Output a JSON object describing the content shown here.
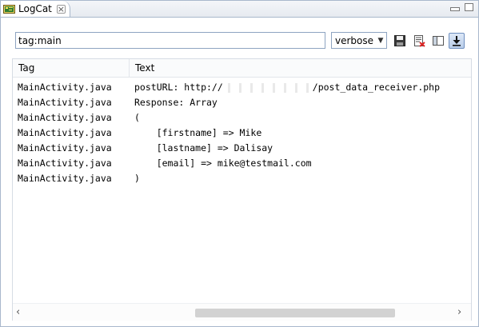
{
  "tab": {
    "title": "LogCat"
  },
  "toolbar": {
    "filter_value": "tag:main",
    "level": "verbose",
    "save_icon": "save-icon",
    "clear_icon": "clear-log-icon",
    "panel_icon": "toggle-panel-icon",
    "scroll_icon": "scroll-lock-icon"
  },
  "table": {
    "headers": [
      "Tag",
      "Text"
    ],
    "rows": [
      {
        "tag": "MainActivity.java",
        "text_prefix": "postURL: http://",
        "text_suffix": "/post_data_receiver.php"
      },
      {
        "tag": "MainActivity.java",
        "text": "Response: Array"
      },
      {
        "tag": "MainActivity.java",
        "text": "("
      },
      {
        "tag": "MainActivity.java",
        "text": "    [firstname] => Mike"
      },
      {
        "tag": "MainActivity.java",
        "text": "    [lastname] => Dalisay"
      },
      {
        "tag": "MainActivity.java",
        "text": "    [email] => mike@testmail.com"
      },
      {
        "tag": "MainActivity.java",
        "text": ")"
      }
    ]
  },
  "colors": {
    "border": "#a9b8cc",
    "scroll_thumb": "#d2d2d2"
  }
}
